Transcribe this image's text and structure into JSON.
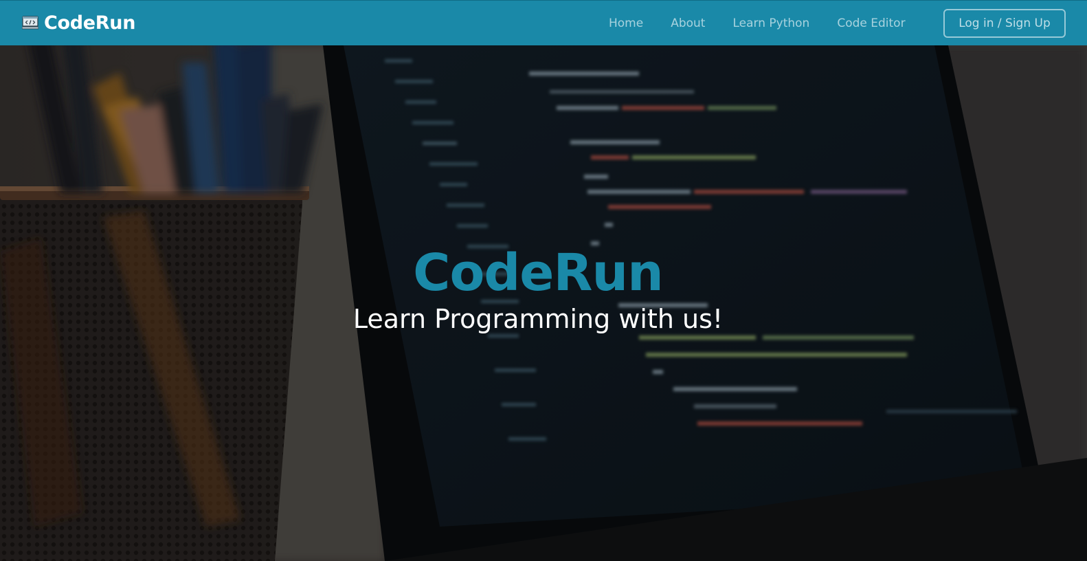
{
  "navbar": {
    "brand": {
      "icon": "code-window-icon",
      "name": "CodeRun"
    },
    "links": [
      {
        "label": "Home"
      },
      {
        "label": "About"
      },
      {
        "label": "Learn Python"
      },
      {
        "label": "Code Editor"
      }
    ],
    "login_label": "Log in / Sign Up"
  },
  "hero": {
    "title": "CodeRun",
    "subtitle": "Learn Programming with us!",
    "background": "laptop-code-photo"
  },
  "colors": {
    "brand": "#1a89a8",
    "hero_text": "#ffffff"
  }
}
